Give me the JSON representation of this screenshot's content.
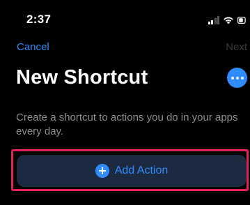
{
  "status_bar": {
    "time": "2:37",
    "icons": [
      "signal-icon",
      "wifi-icon",
      "battery-icon"
    ]
  },
  "nav": {
    "cancel_label": "Cancel",
    "next_label": "Next"
  },
  "header": {
    "title": "New Shortcut",
    "more_icon": "ellipsis-icon"
  },
  "main": {
    "description": "Create a shortcut to actions you do in your apps every day.",
    "add_action_label": "Add Action",
    "add_action_icon": "plus-circle-icon"
  },
  "colors": {
    "accent": "#2f8cff",
    "highlight": "#e3215a",
    "button_bg": "#1b2a40",
    "background": "#000000"
  }
}
